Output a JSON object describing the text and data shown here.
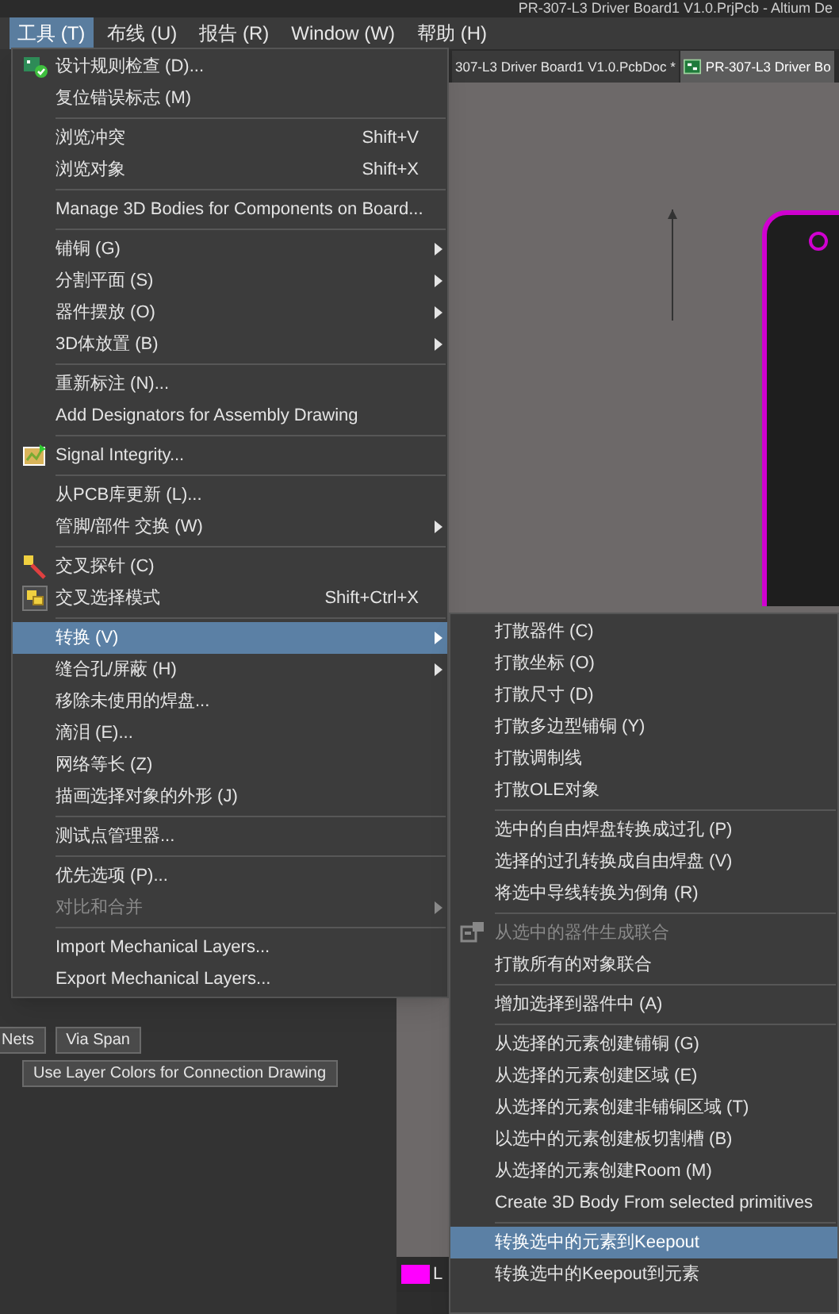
{
  "window": {
    "title": "PR-307-L3 Driver Board1 V1.0.PrjPcb - Altium De"
  },
  "menu_bar": [
    {
      "label": "工具 (T)",
      "selected": true
    },
    {
      "label": "布线 (U)",
      "selected": false
    },
    {
      "label": "报告 (R)",
      "selected": false
    },
    {
      "label": "Window (W)",
      "selected": false
    },
    {
      "label": "帮助 (H)",
      "selected": false
    }
  ],
  "document_tabs": [
    {
      "label": "307-L3 Driver Board1 V1.0.PcbDoc *",
      "selected": false
    },
    {
      "label": "PR-307-L3 Driver Bo",
      "selected": true
    }
  ],
  "panel_buttons": [
    [
      "Nets",
      "Via Span"
    ],
    [
      "Use Layer Colors for Connection Drawing"
    ]
  ],
  "layer_tab": {
    "label": "L",
    "color": "#ff00ff"
  },
  "tools_menu": [
    [
      {
        "label": "设计规则检查 (D)...",
        "selected": false,
        "disabled": false,
        "has_submenu": false
      },
      {
        "label": "复位错误标志 (M)",
        "selected": false,
        "disabled": false,
        "has_submenu": false
      }
    ],
    [
      {
        "label": "浏览冲突",
        "shortcut": "Shift+V",
        "selected": false,
        "disabled": false,
        "has_submenu": false
      },
      {
        "label": "浏览对象",
        "shortcut": "Shift+X",
        "selected": false,
        "disabled": false,
        "has_submenu": false
      }
    ],
    [
      {
        "label": "Manage 3D Bodies for Components on Board...",
        "selected": false,
        "disabled": false,
        "has_submenu": false
      }
    ],
    [
      {
        "label": "铺铜 (G)",
        "selected": false,
        "disabled": false,
        "has_submenu": true
      },
      {
        "label": "分割平面 (S)",
        "selected": false,
        "disabled": false,
        "has_submenu": true
      },
      {
        "label": "器件摆放 (O)",
        "selected": false,
        "disabled": false,
        "has_submenu": true
      },
      {
        "label": "3D体放置 (B)",
        "selected": false,
        "disabled": false,
        "has_submenu": true
      }
    ],
    [
      {
        "label": "重新标注 (N)...",
        "selected": false,
        "disabled": false,
        "has_submenu": false
      },
      {
        "label": "Add Designators for Assembly Drawing",
        "selected": false,
        "disabled": false,
        "has_submenu": false
      }
    ],
    [
      {
        "label": "Signal Integrity...",
        "selected": false,
        "disabled": false,
        "has_submenu": false
      }
    ],
    [
      {
        "label": "从PCB库更新 (L)...",
        "selected": false,
        "disabled": false,
        "has_submenu": false
      },
      {
        "label": "管脚/部件 交换 (W)",
        "selected": false,
        "disabled": false,
        "has_submenu": true
      }
    ],
    [
      {
        "label": "交叉探针 (C)",
        "selected": false,
        "disabled": false,
        "has_submenu": false
      },
      {
        "label": "交叉选择模式",
        "shortcut": "Shift+Ctrl+X",
        "selected": false,
        "disabled": false,
        "has_submenu": false
      }
    ],
    [
      {
        "label": "转换 (V)",
        "selected": true,
        "disabled": false,
        "has_submenu": true
      },
      {
        "label": "缝合孔/屏蔽 (H)",
        "selected": false,
        "disabled": false,
        "has_submenu": true
      },
      {
        "label": "移除未使用的焊盘...",
        "selected": false,
        "disabled": false,
        "has_submenu": false
      },
      {
        "label": "滴泪 (E)...",
        "selected": false,
        "disabled": false,
        "has_submenu": false
      },
      {
        "label": "网络等长 (Z)",
        "selected": false,
        "disabled": false,
        "has_submenu": false
      },
      {
        "label": "描画选择对象的外形 (J)",
        "selected": false,
        "disabled": false,
        "has_submenu": false
      }
    ],
    [
      {
        "label": "测试点管理器...",
        "selected": false,
        "disabled": false,
        "has_submenu": false
      }
    ],
    [
      {
        "label": "优先选项 (P)...",
        "selected": false,
        "disabled": false,
        "has_submenu": false
      },
      {
        "label": "对比和合并",
        "selected": false,
        "disabled": true,
        "has_submenu": true
      }
    ],
    [
      {
        "label": "Import Mechanical Layers...",
        "selected": false,
        "disabled": false,
        "has_submenu": false
      },
      {
        "label": "Export Mechanical Layers...",
        "selected": false,
        "disabled": false,
        "has_submenu": false
      }
    ]
  ],
  "convert_submenu": [
    [
      {
        "label": "打散器件 (C)",
        "selected": false,
        "disabled": false
      },
      {
        "label": "打散坐标 (O)",
        "selected": false,
        "disabled": false
      },
      {
        "label": "打散尺寸 (D)",
        "selected": false,
        "disabled": false
      },
      {
        "label": "打散多边型铺铜 (Y)",
        "selected": false,
        "disabled": false
      },
      {
        "label": "打散调制线",
        "selected": false,
        "disabled": false
      },
      {
        "label": "打散OLE对象",
        "selected": false,
        "disabled": false
      }
    ],
    [
      {
        "label": "选中的自由焊盘转换成过孔 (P)",
        "selected": false,
        "disabled": false
      },
      {
        "label": "选择的过孔转换成自由焊盘 (V)",
        "selected": false,
        "disabled": false
      },
      {
        "label": "将选中导线转换为倒角 (R)",
        "selected": false,
        "disabled": false
      }
    ],
    [
      {
        "label": "从选中的器件生成联合",
        "selected": false,
        "disabled": true
      },
      {
        "label": "打散所有的对象联合",
        "selected": false,
        "disabled": false
      }
    ],
    [
      {
        "label": "增加选择到器件中 (A)",
        "selected": false,
        "disabled": false
      }
    ],
    [
      {
        "label": "从选择的元素创建铺铜 (G)",
        "selected": false,
        "disabled": false
      },
      {
        "label": "从选择的元素创建区域 (E)",
        "selected": false,
        "disabled": false
      },
      {
        "label": "从选择的元素创建非铺铜区域 (T)",
        "selected": false,
        "disabled": false
      },
      {
        "label": "以选中的元素创建板切割槽 (B)",
        "selected": false,
        "disabled": false
      },
      {
        "label": "从选择的元素创建Room (M)",
        "selected": false,
        "disabled": false
      },
      {
        "label": "Create 3D Body From selected primitives",
        "selected": false,
        "disabled": false
      }
    ],
    [
      {
        "label": "转换选中的元素到Keepout",
        "selected": true,
        "disabled": false
      },
      {
        "label": "转换选中的Keepout到元素",
        "selected": false,
        "disabled": false
      }
    ]
  ]
}
